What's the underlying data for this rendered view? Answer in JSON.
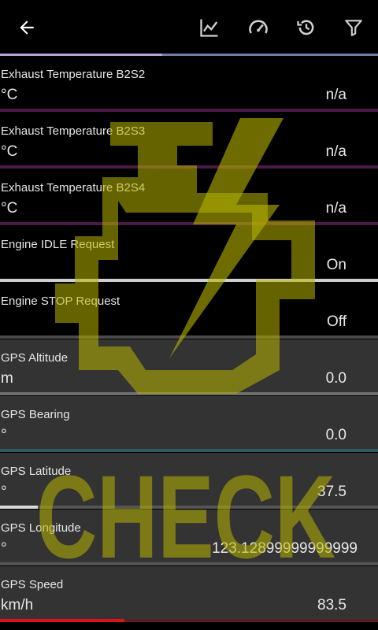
{
  "toolbar": {
    "icons": [
      "back-arrow-icon",
      "chart-line-icon",
      "speedometer-icon",
      "history-icon",
      "filter-icon"
    ],
    "progress": 0.43
  },
  "watermark": {
    "text": "CHECK",
    "color": "#c8c400"
  },
  "rows": [
    {
      "label": "Exhaust Temperature B2S2",
      "unit": "°C",
      "value": "n/a",
      "level": 0,
      "track_color": "#4a1a47",
      "fill_color": "#4a1a47",
      "bg": "#000000"
    },
    {
      "label": "Exhaust Temperature B2S3",
      "unit": "°C",
      "value": "n/a",
      "level": 0,
      "track_color": "#4a1a47",
      "fill_color": "#4a1a47",
      "bg": "#000000"
    },
    {
      "label": "Exhaust Temperature B2S4",
      "unit": "°C",
      "value": "n/a",
      "level": 0,
      "track_color": "#4a1a47",
      "fill_color": "#4a1a47",
      "bg": "#000000"
    },
    {
      "label": "Engine IDLE Request",
      "unit": "",
      "value": "On",
      "level": 1,
      "track_color": "#cfcfcf",
      "fill_color": "#cfcfcf",
      "bg": "#000000"
    },
    {
      "label": "Engine STOP Request",
      "unit": "",
      "value": "Off",
      "level": 0,
      "track_color": "#4a4a4a",
      "fill_color": "#4a4a4a",
      "bg": "#000000"
    },
    {
      "label": "GPS Altitude",
      "unit": "m",
      "value": "0.0",
      "level": 0,
      "track_color": "#6e6e6e",
      "fill_color": "#6e6e6e",
      "bg": "#333333"
    },
    {
      "label": "GPS Bearing",
      "unit": "°",
      "value": "0.0",
      "level": 0,
      "track_color": "#2f5a5e",
      "fill_color": "#2f5a5e",
      "bg": "#333333"
    },
    {
      "label": "GPS Latitude",
      "unit": "°",
      "value": "37.5",
      "level": 0.1,
      "track_color": "#555555",
      "fill_color": "#d9d9d9",
      "bg": "#333333"
    },
    {
      "label": "GPS Longitude",
      "unit": "°",
      "value": "123.12899999999999",
      "level": 0,
      "track_color": "#555555",
      "fill_color": "#555555",
      "bg": "#333333"
    },
    {
      "label": "GPS Speed",
      "unit": "km/h",
      "value": "83.5",
      "level": 0.33,
      "track_color": "#5a1d1d",
      "fill_color": "#e0101a",
      "bg": "#333333"
    }
  ]
}
